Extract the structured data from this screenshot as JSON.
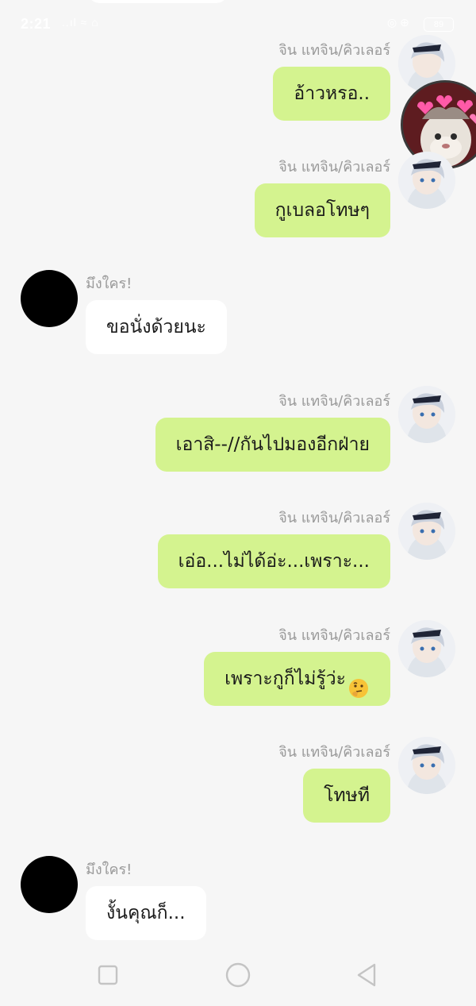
{
  "status_bar": {
    "time": "2:21",
    "signal": "..ıl ≈ ⌂",
    "battery": "89"
  },
  "participants": {
    "me": {
      "name": "จิน แทจิน/คิวเลอร์"
    },
    "them": {
      "name": "มึงใคร!"
    }
  },
  "messages": [
    {
      "sender": "me",
      "name": "จิน แทจิน/คิวเลอร์",
      "text": "อ้าวหรอ.."
    },
    {
      "sender": "me",
      "name": "จิน แทจิน/คิวเลอร์",
      "text": "กูเบลอโทษๆ"
    },
    {
      "sender": "them",
      "name": "มึงใคร!",
      "text": "ขอนั่งด้วยนะ"
    },
    {
      "sender": "me",
      "name": "จิน แทจิน/คิวเลอร์",
      "text": "เอาสิ--//กันไปมองอีกฝ่าย"
    },
    {
      "sender": "me",
      "name": "จิน แทจิน/คิวเลอร์",
      "text": "เอ่อ...ไม่ได้อ่ะ...เพราะ..."
    },
    {
      "sender": "me",
      "name": "จิน แทจิน/คิวเลอร์",
      "text": "เพราะกูก็ไม่รู้ว่ะ",
      "emoji": "thinking-face-emoji"
    },
    {
      "sender": "me",
      "name": "จิน แทจิน/คิวเลอร์",
      "text": "โทษที"
    },
    {
      "sender": "them",
      "name": "มึงใคร!",
      "text": "งั้นคุณก็..."
    }
  ],
  "nav": {
    "recent_icon": "square-recents-icon",
    "home_icon": "circle-home-icon",
    "back_icon": "triangle-back-icon"
  },
  "colors": {
    "my_bubble": "#d4f38f",
    "their_bubble": "#ffffff",
    "background": "#f6f6f6",
    "name_text": "#9a9a9a"
  }
}
